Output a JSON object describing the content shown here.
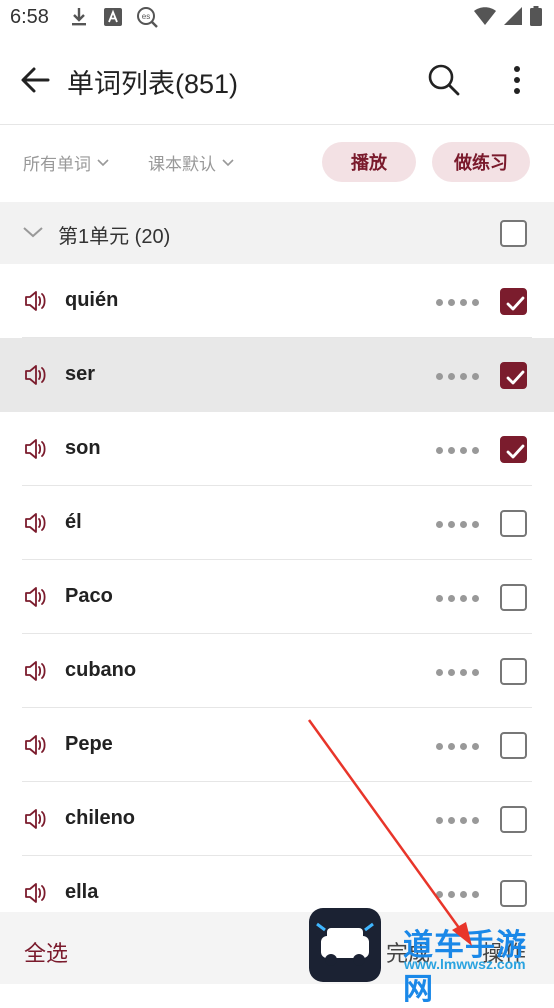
{
  "status_bar": {
    "time": "6:58",
    "left_icons": [
      "download-icon",
      "font-a-icon",
      "es-search-icon"
    ],
    "right_icons": [
      "wifi-icon",
      "signal-icon",
      "battery-icon"
    ]
  },
  "header": {
    "title": "单词列表(851)",
    "back_icon": "arrow-left-icon",
    "search_icon": "search-icon",
    "more_icon": "more-vertical-icon"
  },
  "filters": {
    "scope": "所有单词",
    "order": "课本默认",
    "play_label": "播放",
    "practice_label": "做练习"
  },
  "unit": {
    "title": "第1单元 (20)",
    "checked": false
  },
  "words": [
    {
      "text": "quién",
      "checked": true,
      "highlight": false
    },
    {
      "text": "ser",
      "checked": true,
      "highlight": true
    },
    {
      "text": "son",
      "checked": true,
      "highlight": false
    },
    {
      "text": "él",
      "checked": false,
      "highlight": false
    },
    {
      "text": "Paco",
      "checked": false,
      "highlight": false
    },
    {
      "text": "cubano",
      "checked": false,
      "highlight": false
    },
    {
      "text": "Pepe",
      "checked": false,
      "highlight": false
    },
    {
      "text": "chileno",
      "checked": false,
      "highlight": false
    },
    {
      "text": "ella",
      "checked": false,
      "highlight": false
    }
  ],
  "bottom_bar": {
    "select_all": "全选",
    "done": "完成",
    "operations": "操作"
  },
  "watermark": {
    "text": "道车手游网",
    "url": "www.lmwwsz.com"
  },
  "colors": {
    "accent": "#7b1c2d",
    "pill_bg": "#f3e1e4",
    "highlight_row": "#e8e8e8",
    "arrow": "#e8352a"
  }
}
